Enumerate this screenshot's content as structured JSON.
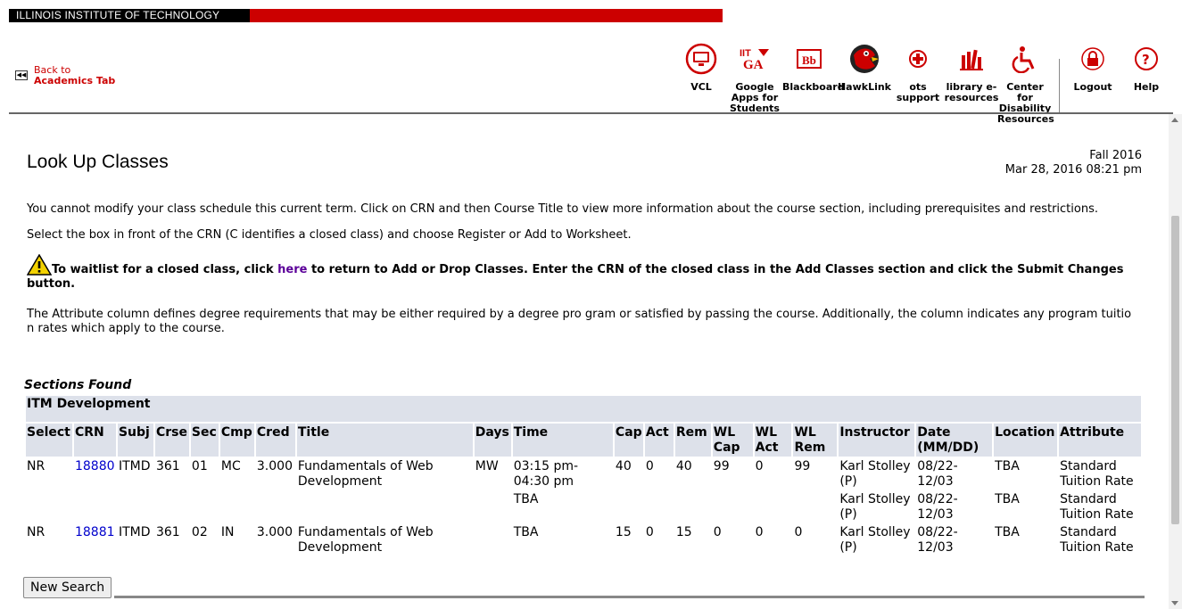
{
  "banner": {
    "school": "ILLINOIS INSTITUTE OF TECHNOLOGY"
  },
  "back": {
    "line1": "Back to",
    "line2": "Academics Tab"
  },
  "nav": [
    {
      "label": "VCL",
      "icon": "vcl-monitor-icon"
    },
    {
      "label": "Google Apps for Students",
      "icon": "google-apps-icon"
    },
    {
      "label": "Blackboard",
      "icon": "blackboard-icon"
    },
    {
      "label": "HawkLink",
      "icon": "hawk-icon"
    },
    {
      "label": "ots support",
      "icon": "support-icon"
    },
    {
      "label": "library e-resources",
      "icon": "library-icon"
    },
    {
      "label": "Center for Disability Resources",
      "icon": "accessibility-icon"
    },
    {
      "label": "Logout",
      "icon": "lock-icon"
    },
    {
      "label": "Help",
      "icon": "help-icon"
    }
  ],
  "page": {
    "title": "Look Up Classes",
    "term": "Fall 2016",
    "datetime": "Mar 28, 2016 08:21 pm"
  },
  "info": {
    "p1": "You cannot modify your class schedule this current term. Click on CRN and then Course Title to view more information about the course section, including prerequisites and restrictions.",
    "p2": "Select the box in front of the CRN (C identifies a closed class) and choose Register or Add to Worksheet.",
    "warn_before": "To waitlist for a closed class, click ",
    "warn_link": "here",
    "warn_after": " to return to Add or Drop Classes. Enter the CRN of the closed class in the Add Classes section and click the Submit Changes button.",
    "p4": "The Attribute column defines degree requirements that may be either required by a degree pro gram or satisfied by passing the course. Additionally, the column indicates any program tuitio n rates which apply to the course."
  },
  "results": {
    "heading": "Sections Found",
    "group": "ITM Development",
    "columns": [
      "Select",
      "CRN",
      "Subj",
      "Crse",
      "Sec",
      "Cmp",
      "Cred",
      "Title",
      "Days",
      "Time",
      "Cap",
      "Act",
      "Rem",
      "WL Cap",
      "WL Act",
      "WL Rem",
      "Instructor",
      "Date (MM/DD)",
      "Location",
      "Attribute"
    ],
    "rows": [
      [
        "NR",
        "18880",
        "ITMD",
        "361",
        "01",
        "MC",
        "3.000",
        "Fundamentals of Web Development",
        "MW",
        "03:15 pm-04:30 pm",
        "40",
        "0",
        "40",
        "99",
        "0",
        "99",
        "Karl Stolley (P)",
        "08/22-12/03",
        "TBA",
        "Standard Tuition Rate"
      ],
      [
        "",
        "",
        "",
        "",
        "",
        "",
        "",
        "",
        "",
        "TBA",
        "",
        "",
        "",
        "",
        "",
        "",
        "Karl Stolley (P)",
        "08/22-12/03",
        "TBA",
        "Standard Tuition Rate"
      ],
      [
        "NR",
        "18881",
        "ITMD",
        "361",
        "02",
        "IN",
        "3.000",
        "Fundamentals of Web Development",
        "",
        "TBA",
        "15",
        "0",
        "15",
        "0",
        "0",
        "0",
        "Karl Stolley (P)",
        "08/22-12/03",
        "TBA",
        "Standard Tuition Rate"
      ]
    ]
  },
  "buttons": {
    "new_search": "New Search"
  },
  "colors": {
    "brand_red": "#cc0000",
    "header_bg": "#dde1ea",
    "link_blue": "#0000cc"
  }
}
